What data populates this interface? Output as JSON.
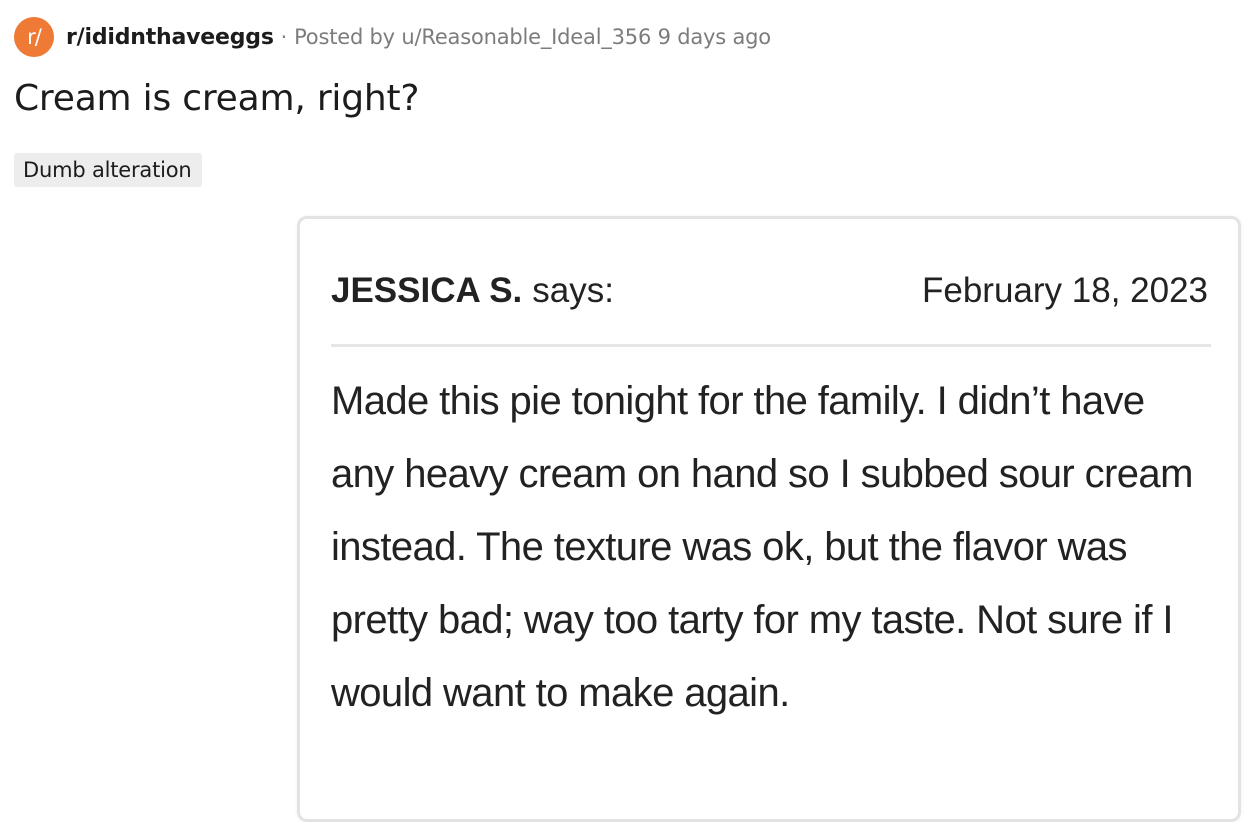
{
  "post": {
    "subreddit_icon_text": "r/",
    "subreddit": "r/ididnthaveeggs",
    "separator": "·",
    "posted_by_prefix": "Posted by",
    "author": "u/Reasonable_Ideal_356",
    "age": "9 days ago",
    "title": "Cream is cream, right?",
    "flair": "Dumb alteration",
    "accent_color": "#ef7a35"
  },
  "comment": {
    "author": "JESSICA S.",
    "says": "says:",
    "date": "February 18, 2023",
    "body": "Made this pie tonight for the family. I didn’t have any heavy cream on hand so I subbed sour cream instead. The texture was ok, but the flavor was pretty bad; way too tarty for my taste. Not sure if I would want to make again."
  }
}
